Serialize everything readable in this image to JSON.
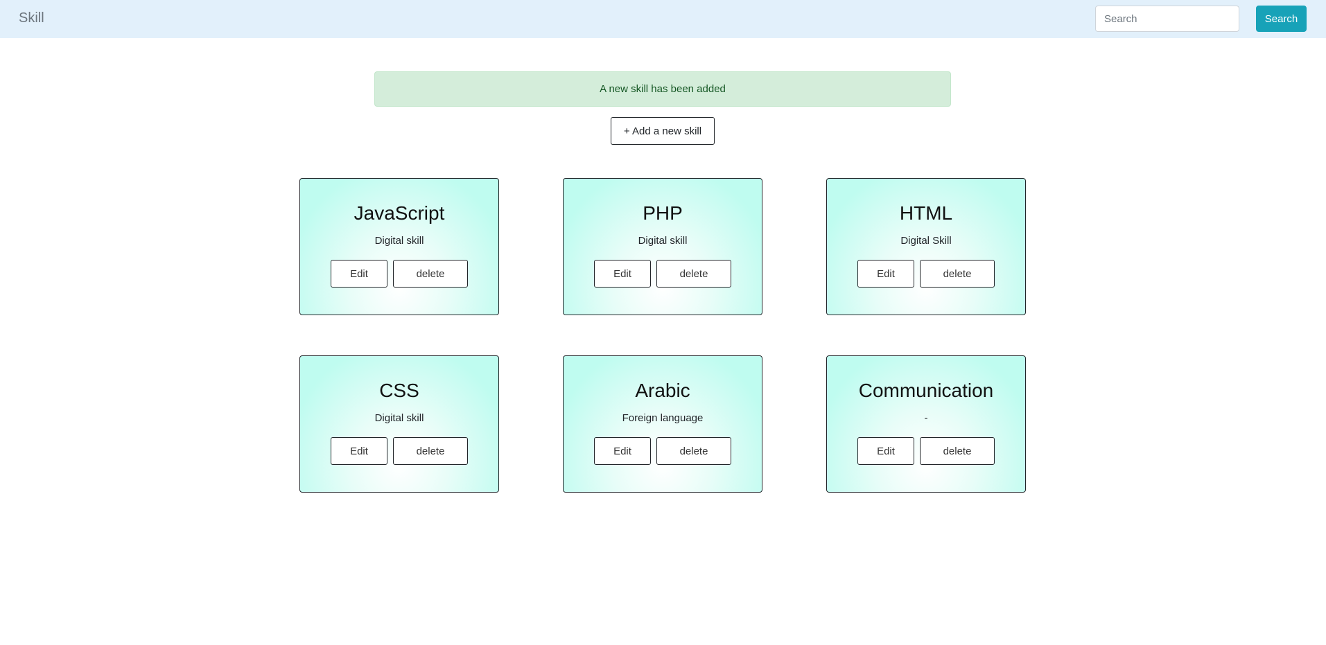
{
  "navbar": {
    "brand": "Skill",
    "search_placeholder": "Search",
    "search_button_label": "Search"
  },
  "alert": {
    "message": "A new skill has been added"
  },
  "add_button_label": "+ Add a new skill",
  "skills": [
    {
      "name": "JavaScript",
      "category": "Digital skill",
      "edit_label": "Edit",
      "delete_label": "delete"
    },
    {
      "name": "PHP",
      "category": "Digital skill",
      "edit_label": "Edit",
      "delete_label": "delete"
    },
    {
      "name": "HTML",
      "category": "Digital Skill",
      "edit_label": "Edit",
      "delete_label": "delete"
    },
    {
      "name": "CSS",
      "category": "Digital skill",
      "edit_label": "Edit",
      "delete_label": "delete"
    },
    {
      "name": "Arabic",
      "category": "Foreign language",
      "edit_label": "Edit",
      "delete_label": "delete"
    },
    {
      "name": "Communication",
      "category": "-",
      "edit_label": "Edit",
      "delete_label": "delete"
    }
  ],
  "colors": {
    "navbar_bg": "#e2f0fb",
    "search_button": "#17a2b8",
    "alert_bg": "#d4edda",
    "alert_text": "#155724",
    "card_gradient_top": "#bffcf0"
  }
}
